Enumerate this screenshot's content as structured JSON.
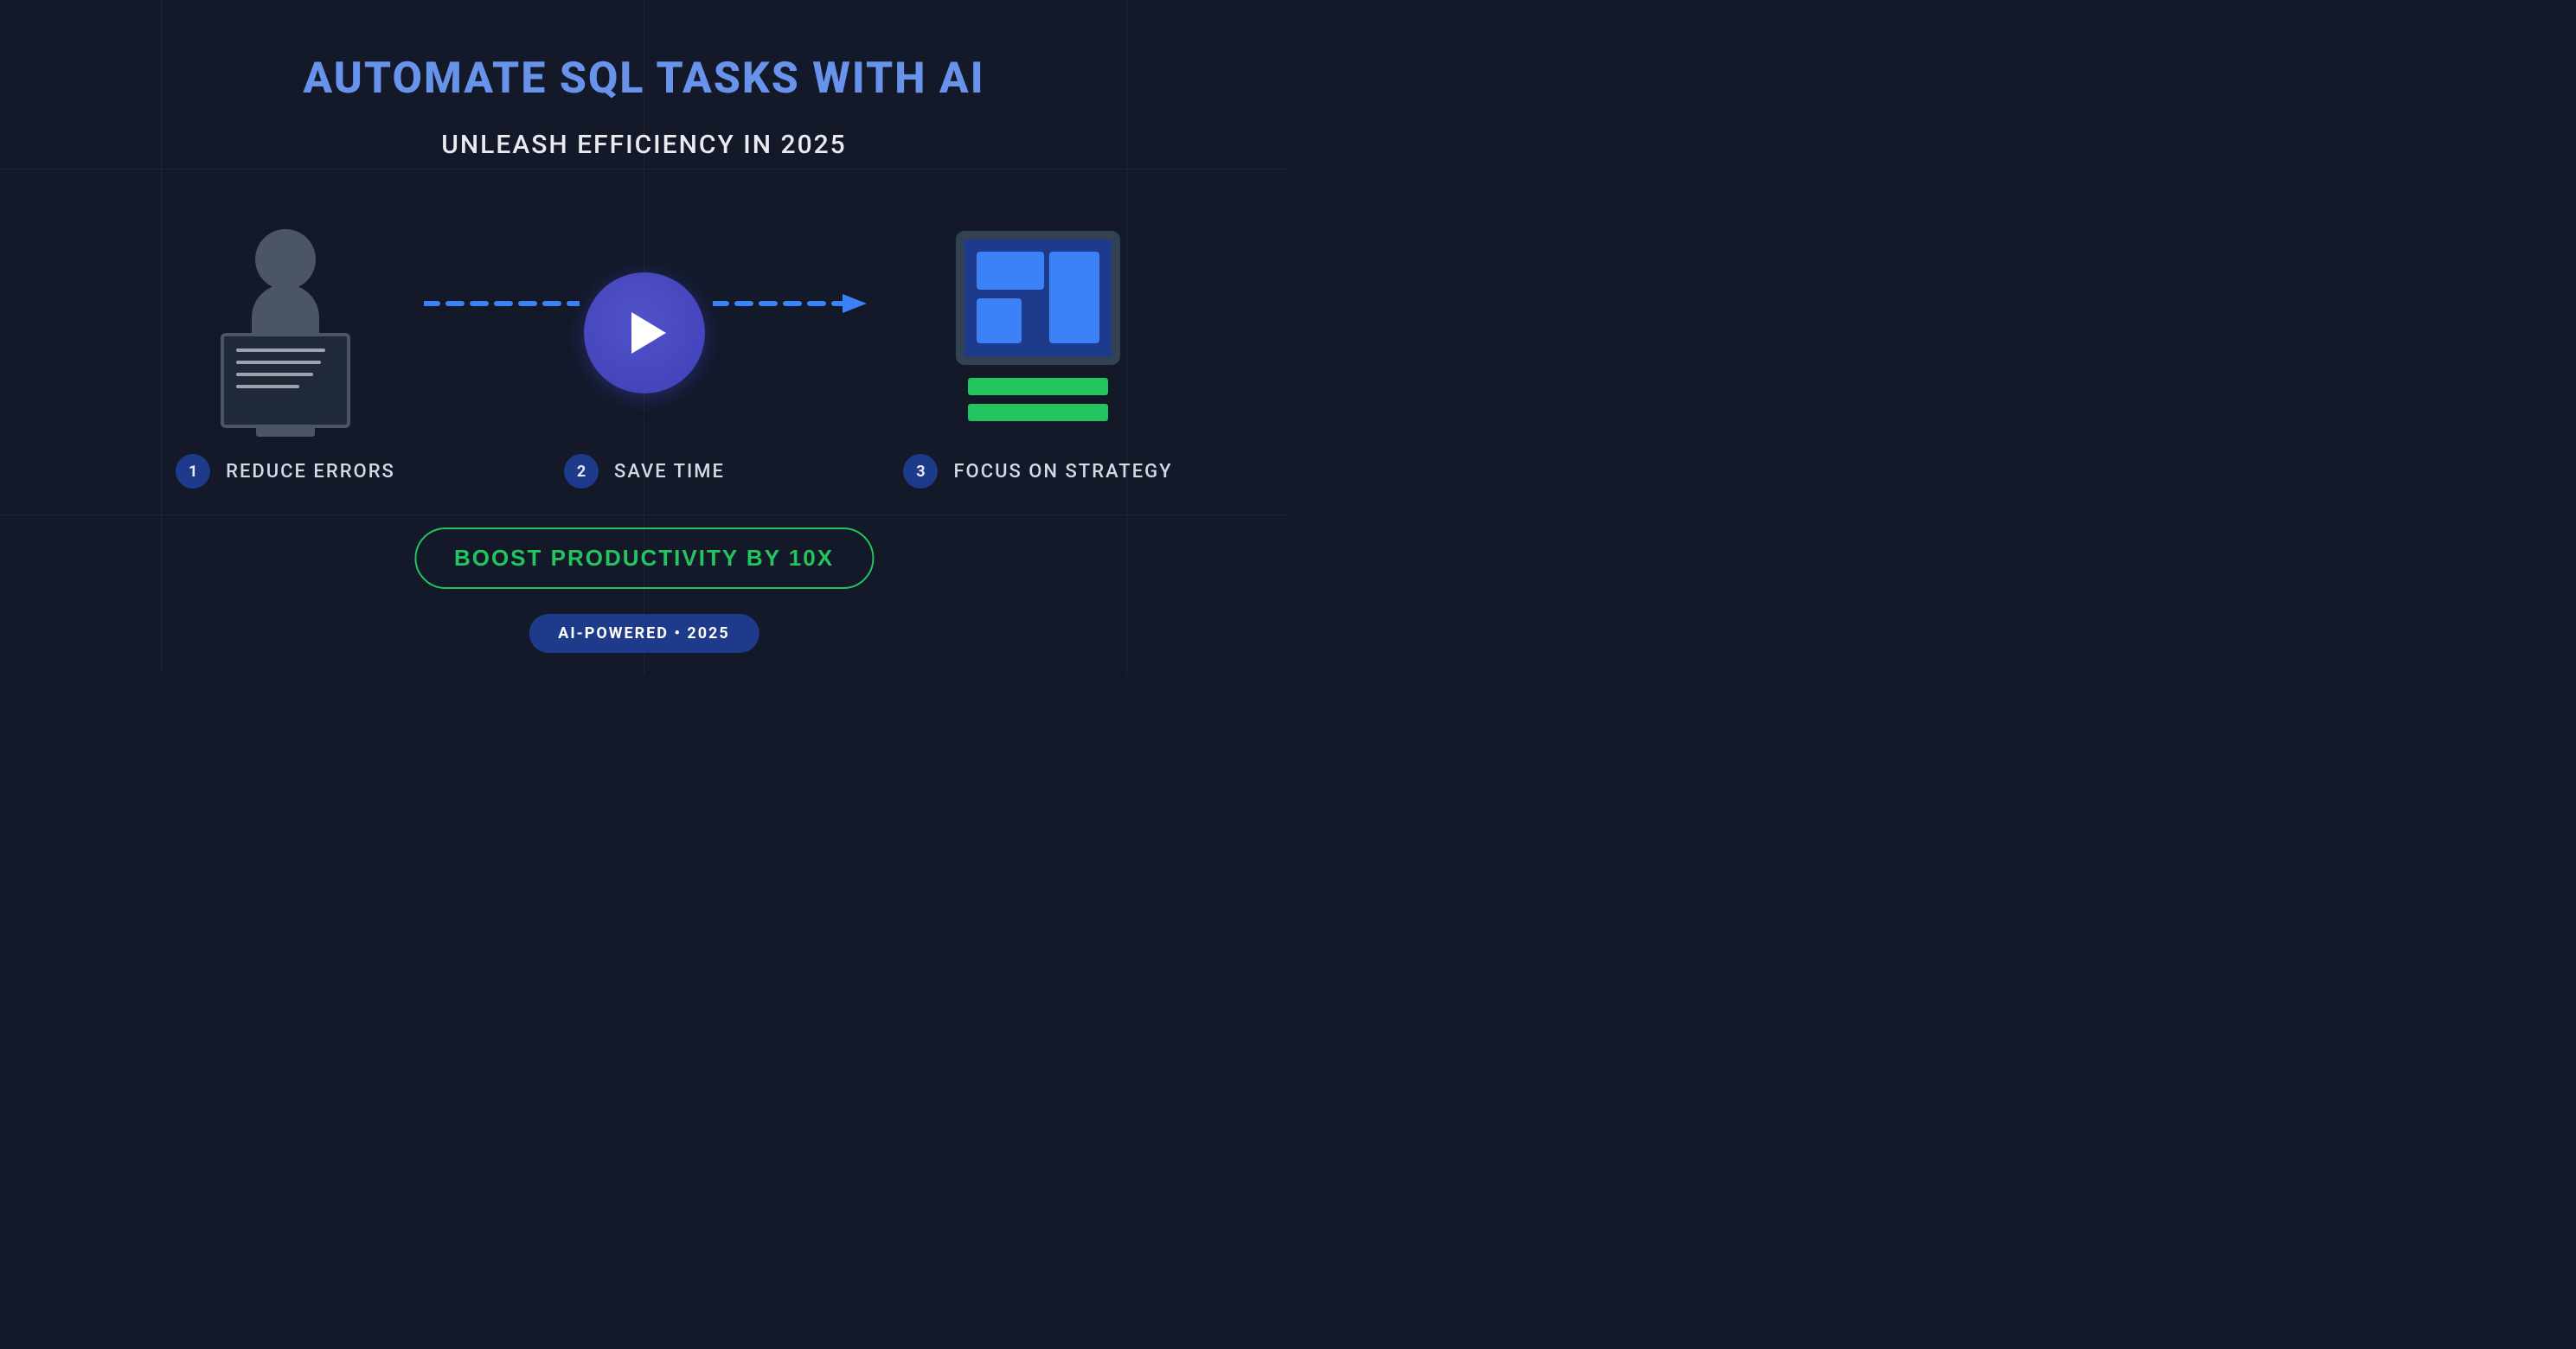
{
  "title": "AUTOMATE SQL TASKS WITH AI",
  "subtitle": "UNLEASH EFFICIENCY IN 2025",
  "steps": [
    {
      "num": "1",
      "label": "REDUCE ERRORS"
    },
    {
      "num": "2",
      "label": "SAVE TIME"
    },
    {
      "num": "3",
      "label": "FOCUS ON STRATEGY"
    }
  ],
  "cta_primary": "BOOST PRODUCTIVITY BY 10X",
  "cta_secondary": "AI-POWERED • 2025",
  "colors": {
    "bg": "#131929",
    "title": "#6893ea",
    "accent_green": "#22c55e",
    "badge_navy": "#1e3a8a",
    "tile_blue": "#3b82f6",
    "monitor_border": "#334155",
    "gray_icon": "#4b5563",
    "play_bg": "#4848c0"
  }
}
